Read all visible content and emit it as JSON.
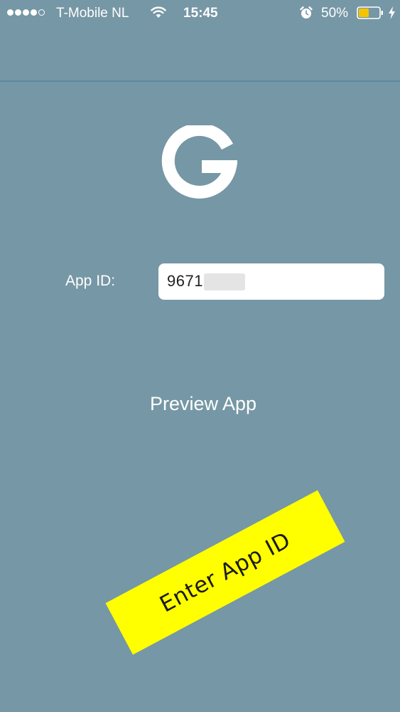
{
  "status_bar": {
    "carrier": "T-Mobile NL",
    "time": "15:45",
    "battery_percent": "50%",
    "battery_level": 0.5,
    "battery_color": "#f5c400",
    "signal_strength": 4,
    "icons": [
      "wifi-icon",
      "alarm-icon",
      "battery-icon",
      "charging-icon"
    ]
  },
  "logo": {
    "letter": "G",
    "color": "#ffffff"
  },
  "form": {
    "app_id_label": "App ID:",
    "app_id_value": "9671"
  },
  "actions": {
    "preview_label": "Preview App"
  },
  "annotation": {
    "text": "Enter App ID",
    "color": "#ffff00"
  },
  "theme": {
    "background": "#7697a5",
    "divider": "#5d8aa0"
  }
}
